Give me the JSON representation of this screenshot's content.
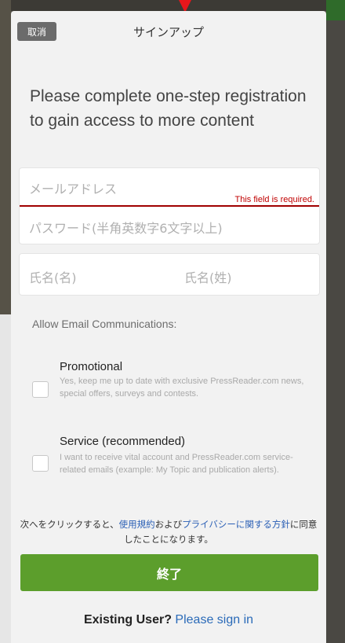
{
  "header": {
    "cancel_label": "取消",
    "title": "サインアップ"
  },
  "headline": "Please complete one-step registration to gain access to more content",
  "form": {
    "email_placeholder": "メールアドレス",
    "email_error": "This field is required.",
    "password_placeholder": "パスワード(半角英数字6文字以上)",
    "first_name_placeholder": "氏名(名)",
    "last_name_placeholder": "氏名(姓)"
  },
  "communications": {
    "label": "Allow Email Communications:",
    "options": [
      {
        "title": "Promotional",
        "description": "Yes, keep me up to date with exclusive PressReader.com news, special offers, surveys and contests.",
        "checked": false
      },
      {
        "title": "Service (recommended)",
        "description": "I want to receive vital account and PressReader.com service-related emails (example: My Topic and publication alerts).",
        "checked": false
      }
    ]
  },
  "terms": {
    "prefix": "次へをクリックすると、",
    "terms_link": "使用規約",
    "and": "および",
    "privacy_link": "プライバシーに関する方針",
    "suffix": "に同意したことになります。"
  },
  "finish_label": "終了",
  "existing_user": {
    "question": "Existing User?",
    "signin_link": "Please sign in"
  },
  "colors": {
    "primary_button": "#5c9e2c",
    "link": "#2a6ab8",
    "error": "#c00000"
  }
}
